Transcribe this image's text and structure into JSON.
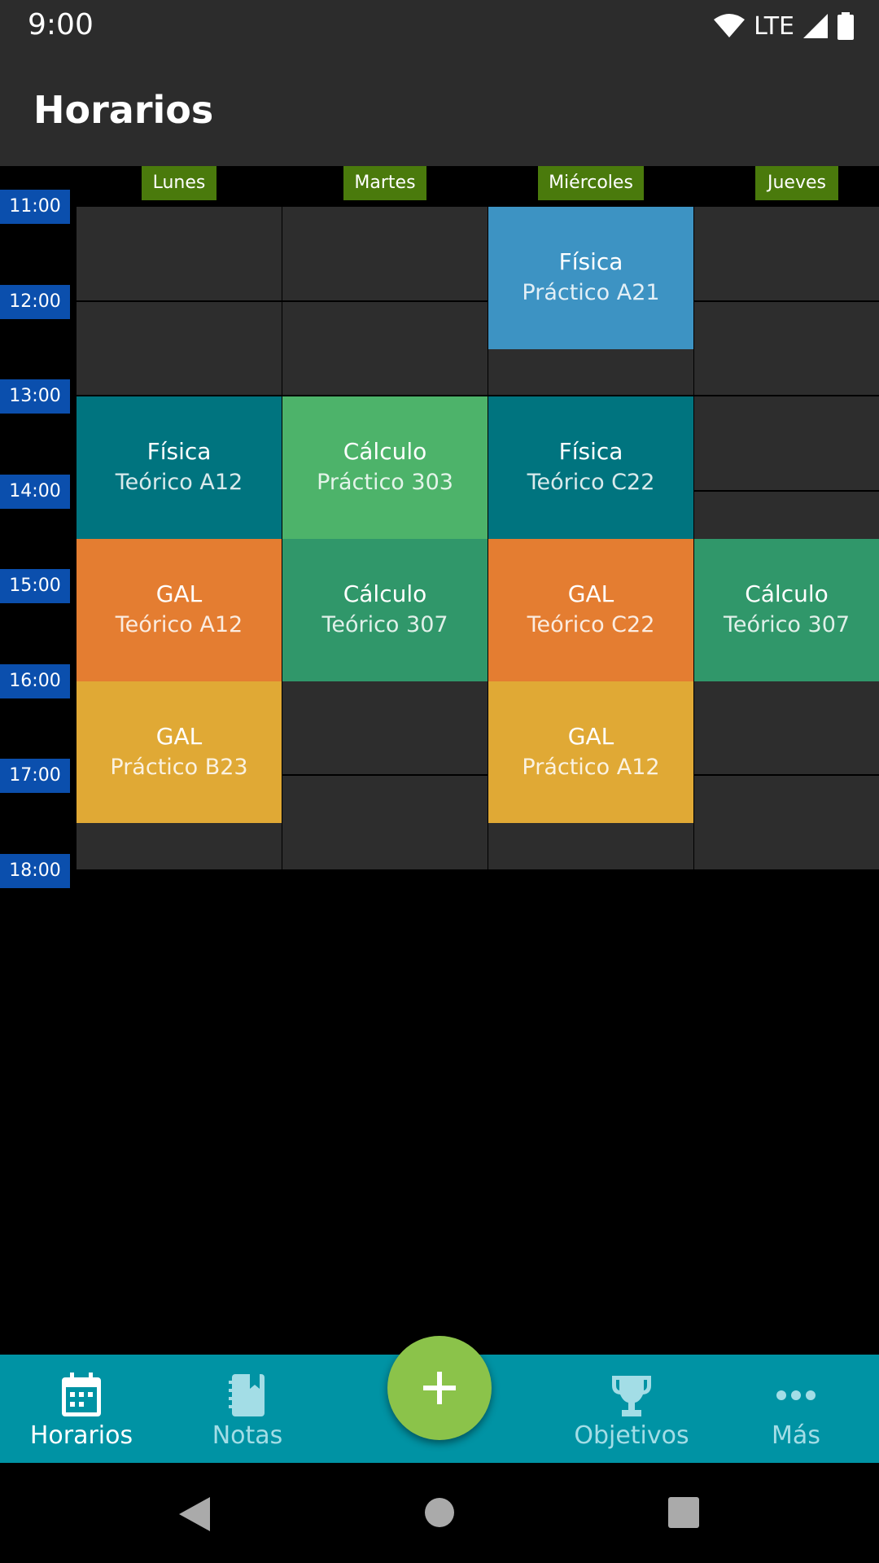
{
  "status_bar": {
    "time": "9:00",
    "network": "LTE"
  },
  "app_bar": {
    "title": "Horarios"
  },
  "schedule": {
    "days": [
      "Lunes",
      "Martes",
      "Miércoles",
      "Jueves"
    ],
    "times": [
      "11:00",
      "12:00",
      "13:00",
      "14:00",
      "15:00",
      "16:00",
      "17:00",
      "18:00"
    ],
    "courses": [
      {
        "name": "Física",
        "room": "Práctico A21",
        "day": "Miércoles",
        "start": "11:00",
        "end": "12:30",
        "color": "#3d93c3"
      },
      {
        "name": "Física",
        "room": "Teórico A12",
        "day": "Lunes",
        "start": "13:00",
        "end": "14:30",
        "color": "#00747f"
      },
      {
        "name": "Cálculo",
        "room": "Práctico 303",
        "day": "Martes",
        "start": "13:00",
        "end": "14:30",
        "color": "#4db36a"
      },
      {
        "name": "Física",
        "room": "Teórico C22",
        "day": "Miércoles",
        "start": "13:00",
        "end": "14:30",
        "color": "#00747f"
      },
      {
        "name": "GAL",
        "room": "Teórico A12",
        "day": "Lunes",
        "start": "14:30",
        "end": "16:00",
        "color": "#e47d31"
      },
      {
        "name": "Cálculo",
        "room": "Teórico 307",
        "day": "Martes",
        "start": "14:30",
        "end": "16:00",
        "color": "#30976a"
      },
      {
        "name": "GAL",
        "room": "Teórico C22",
        "day": "Miércoles",
        "start": "14:30",
        "end": "16:00",
        "color": "#e47d31"
      },
      {
        "name": "Cálculo",
        "room": "Teórico 307",
        "day": "Jueves",
        "start": "14:30",
        "end": "16:00",
        "color": "#30976a"
      },
      {
        "name": "GAL",
        "room": "Práctico B23",
        "day": "Lunes",
        "start": "16:00",
        "end": "17:30",
        "color": "#e0a935"
      },
      {
        "name": "GAL",
        "room": "Práctico A12",
        "day": "Miércoles",
        "start": "16:00",
        "end": "17:30",
        "color": "#e0a935"
      }
    ]
  },
  "bottom_nav": {
    "items": [
      {
        "label": "Horarios",
        "icon": "calendar-icon",
        "active": true
      },
      {
        "label": "Notas",
        "icon": "notebook-icon",
        "active": false
      },
      {
        "label": "Objetivos",
        "icon": "trophy-icon",
        "active": false
      },
      {
        "label": "Más",
        "icon": "more-horizontal-icon",
        "active": false
      }
    ],
    "fab_icon": "plus-icon"
  },
  "colors": {
    "bar_background": "#2c2c2c",
    "day_header": "#4a7a0c",
    "time_label": "#0b4fad",
    "empty_cell": "#2d2d2d",
    "bottom_nav": "#0093a4",
    "fab": "#8bc34a"
  }
}
